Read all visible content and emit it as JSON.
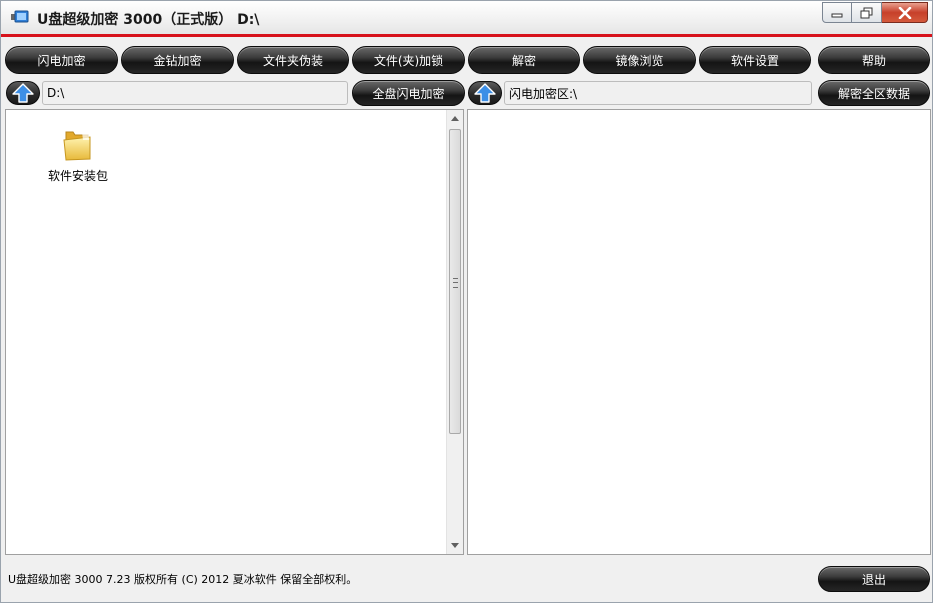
{
  "window": {
    "title": "U盘超级加密 3000（正式版） D:\\"
  },
  "toolbar": {
    "flash_encrypt": "闪电加密",
    "gold_encrypt": "金钻加密",
    "folder_disguise": "文件夹伪装",
    "file_lock": "文件(夹)加锁",
    "decrypt": "解密",
    "mirror_browse": "镜像浏览",
    "settings": "软件设置",
    "help": "帮助"
  },
  "left": {
    "path": "D:\\",
    "whole_disk_button": "全盘闪电加密",
    "items": [
      {
        "label": "软件安装包",
        "icon": "folder-icon"
      }
    ]
  },
  "right": {
    "path": "闪电加密区:\\",
    "decrypt_all_button": "解密全区数据"
  },
  "footer": {
    "copyright": "U盘超级加密 3000  7.23 版权所有 (C) 2012 夏冰软件 保留全部权利。",
    "exit_button": "退出"
  },
  "colors": {
    "accent_red": "#d7121b",
    "button_dark": "#1e1e1e",
    "up_arrow_blue": "#2f7fd9"
  }
}
